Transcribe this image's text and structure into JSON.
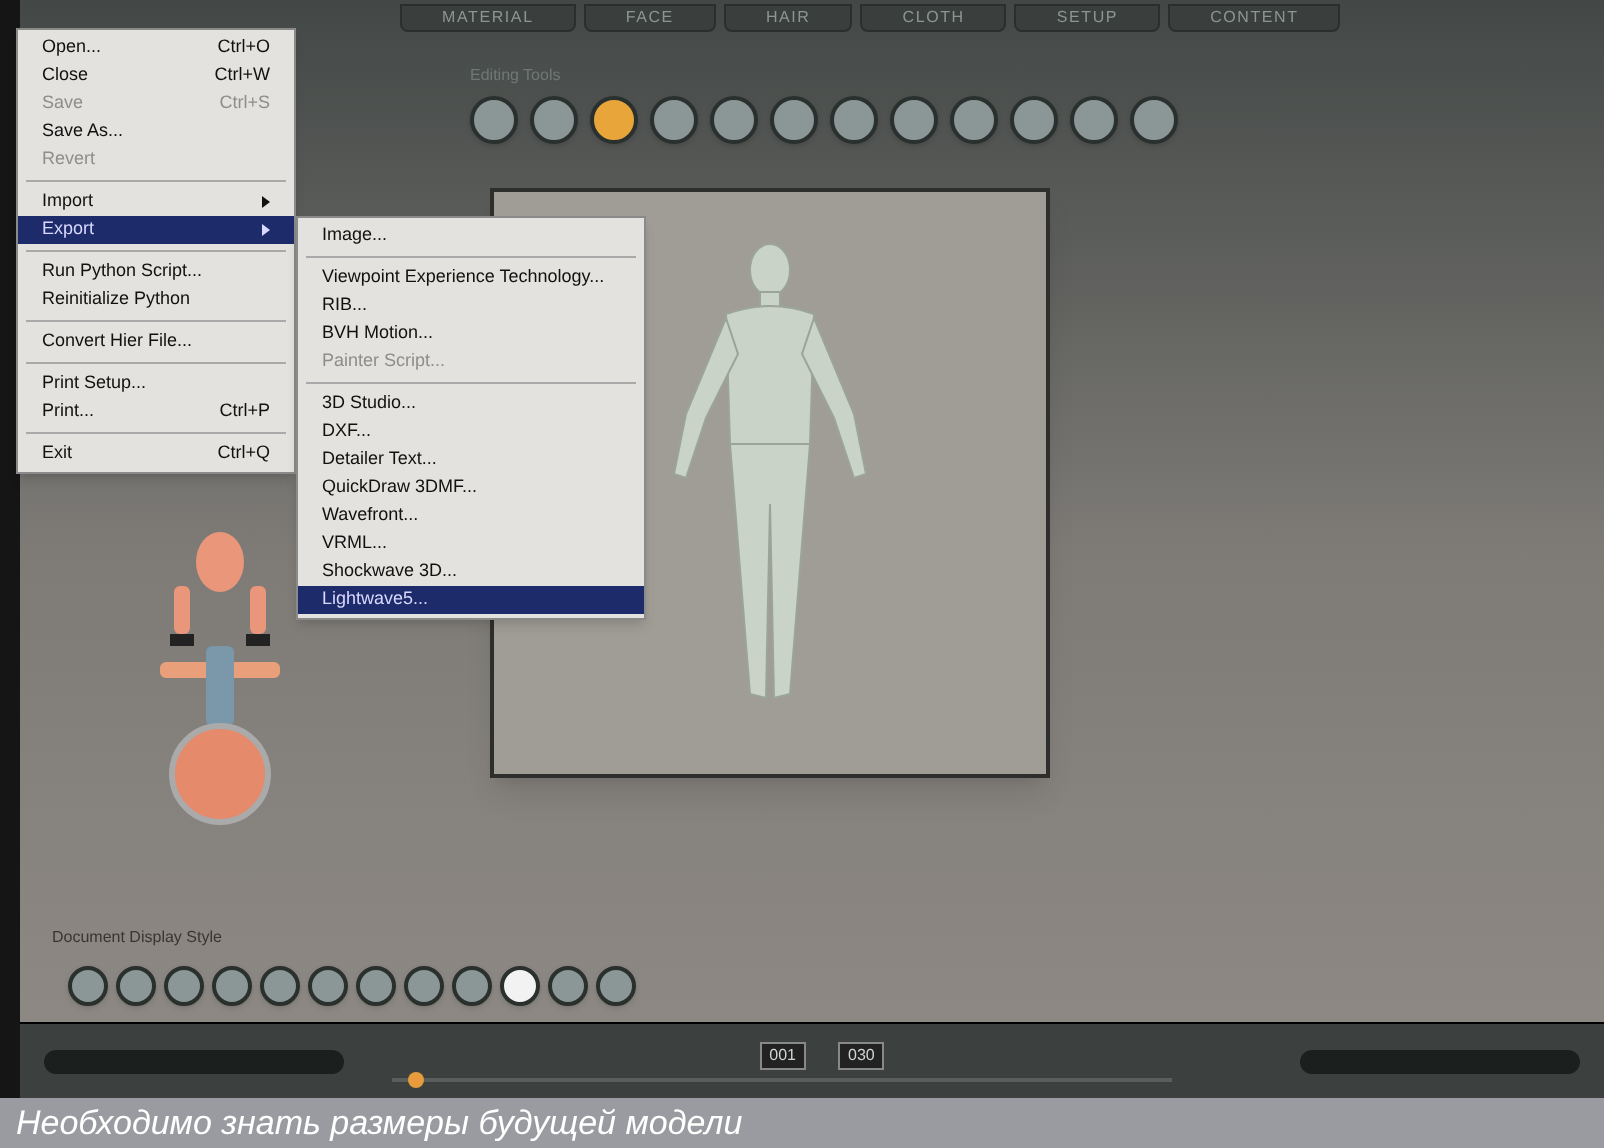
{
  "tabs": [
    {
      "label": "MATERIAL",
      "selected": false
    },
    {
      "label": "FACE",
      "selected": false
    },
    {
      "label": "HAIR",
      "selected": false
    },
    {
      "label": "CLOTH",
      "selected": false
    },
    {
      "label": "SETUP",
      "selected": false
    },
    {
      "label": "CONTENT",
      "selected": false
    }
  ],
  "editing_tools": {
    "label": "Editing Tools",
    "buttons": [
      {
        "selected": false
      },
      {
        "selected": false
      },
      {
        "selected": true
      },
      {
        "selected": false
      },
      {
        "selected": false
      },
      {
        "selected": false
      },
      {
        "selected": false
      },
      {
        "selected": false
      },
      {
        "selected": false
      },
      {
        "selected": false
      },
      {
        "selected": false
      },
      {
        "selected": false
      }
    ]
  },
  "file_menu": [
    {
      "kind": "item",
      "label": "Open...",
      "shortcut": "Ctrl+O",
      "disabled": false,
      "selected": false
    },
    {
      "kind": "item",
      "label": "Close",
      "shortcut": "Ctrl+W",
      "disabled": false,
      "selected": false
    },
    {
      "kind": "item",
      "label": "Save",
      "shortcut": "Ctrl+S",
      "disabled": true,
      "selected": false
    },
    {
      "kind": "item",
      "label": "Save As...",
      "disabled": false,
      "selected": false
    },
    {
      "kind": "item",
      "label": "Revert",
      "disabled": true,
      "selected": false
    },
    {
      "kind": "separator"
    },
    {
      "kind": "submenu",
      "label": "Import",
      "disabled": false,
      "selected": false
    },
    {
      "kind": "submenu",
      "label": "Export",
      "disabled": false,
      "selected": true
    },
    {
      "kind": "separator"
    },
    {
      "kind": "item",
      "label": "Run Python Script...",
      "disabled": false,
      "selected": false
    },
    {
      "kind": "item",
      "label": "Reinitialize Python",
      "disabled": false,
      "selected": false
    },
    {
      "kind": "separator"
    },
    {
      "kind": "item",
      "label": "Convert Hier File...",
      "disabled": false,
      "selected": false
    },
    {
      "kind": "separator"
    },
    {
      "kind": "item",
      "label": "Print Setup...",
      "disabled": false,
      "selected": false
    },
    {
      "kind": "item",
      "label": "Print...",
      "shortcut": "Ctrl+P",
      "disabled": false,
      "selected": false
    },
    {
      "kind": "separator"
    },
    {
      "kind": "item",
      "label": "Exit",
      "shortcut": "Ctrl+Q",
      "disabled": false,
      "selected": false
    }
  ],
  "export_menu": [
    {
      "kind": "item",
      "label": "Image...",
      "disabled": false,
      "selected": false
    },
    {
      "kind": "separator"
    },
    {
      "kind": "item",
      "label": "Viewpoint Experience Technology...",
      "disabled": false,
      "selected": false
    },
    {
      "kind": "item",
      "label": "RIB...",
      "disabled": false,
      "selected": false
    },
    {
      "kind": "item",
      "label": "BVH Motion...",
      "disabled": false,
      "selected": false
    },
    {
      "kind": "item",
      "label": "Painter Script...",
      "disabled": true,
      "selected": false
    },
    {
      "kind": "separator"
    },
    {
      "kind": "item",
      "label": "3D Studio...",
      "disabled": false,
      "selected": false
    },
    {
      "kind": "item",
      "label": "DXF...",
      "disabled": false,
      "selected": false
    },
    {
      "kind": "item",
      "label": "Detailer Text...",
      "disabled": false,
      "selected": false
    },
    {
      "kind": "item",
      "label": "QuickDraw 3DMF...",
      "disabled": false,
      "selected": false
    },
    {
      "kind": "item",
      "label": "Wavefront...",
      "disabled": false,
      "selected": false
    },
    {
      "kind": "item",
      "label": "VRML...",
      "disabled": false,
      "selected": false
    },
    {
      "kind": "item",
      "label": "Shockwave 3D...",
      "disabled": false,
      "selected": false
    },
    {
      "kind": "item",
      "label": "Lightwave5...",
      "disabled": false,
      "selected": true
    }
  ],
  "display_style": {
    "label": "Document Display Style",
    "buttons": [
      {
        "selected": false
      },
      {
        "selected": false
      },
      {
        "selected": false
      },
      {
        "selected": false
      },
      {
        "selected": false
      },
      {
        "selected": false
      },
      {
        "selected": false
      },
      {
        "selected": false
      },
      {
        "selected": false
      },
      {
        "selected": true
      },
      {
        "selected": false
      },
      {
        "selected": false
      }
    ]
  },
  "timeline": {
    "frame": "001",
    "total": "030",
    "level": 0.02
  },
  "caption": "Необходимо знать размеры будущей модели"
}
